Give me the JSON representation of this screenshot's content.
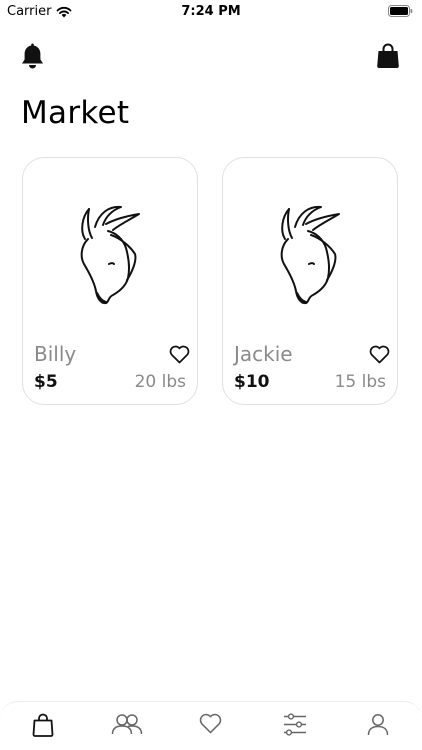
{
  "status_bar": {
    "carrier": "Carrier",
    "time": "7:24 PM"
  },
  "header": {
    "title": "Market"
  },
  "listings": [
    {
      "name": "Billy",
      "price": "$5",
      "weight": "20 lbs"
    },
    {
      "name": "Jackie",
      "price": "$10",
      "weight": "15 lbs"
    }
  ],
  "icons": {
    "notifications": "bell-icon",
    "cart": "shopping-bag-icon",
    "favorite": "heart-icon",
    "tabs": [
      "shopping-bag-icon",
      "people-icon",
      "heart-icon",
      "sliders-icon",
      "person-icon"
    ]
  },
  "colors": {
    "accent": "#111111",
    "muted_text": "#8a8a8a",
    "card_border": "#e1e1e1"
  }
}
